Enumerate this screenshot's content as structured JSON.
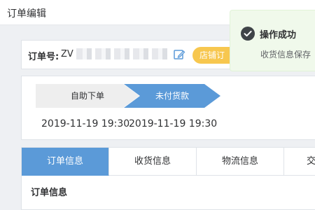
{
  "header": {
    "title": "订单编辑"
  },
  "order": {
    "label": "订单号:",
    "value_visible": "ZV",
    "tag": "店铺订"
  },
  "progress": {
    "steps": [
      {
        "label": "自助下单",
        "time": "2019-11-19 19:30"
      },
      {
        "label": "未付货款",
        "time": "2019-11-19 19:30"
      }
    ]
  },
  "tabs": [
    {
      "label": "订单信息",
      "active": true
    },
    {
      "label": "收货信息",
      "active": false
    },
    {
      "label": "物流信息",
      "active": false
    },
    {
      "label": "交",
      "active": false
    }
  ],
  "section": {
    "title": "订单信息"
  },
  "toast": {
    "title": "操作成功",
    "message": "收货信息保存",
    "icon": "check-circle-icon"
  },
  "colors": {
    "primary": "#5b9ad8",
    "tag": "#f7c74f",
    "success": "#3f4448"
  },
  "icons": {
    "edit": "edit-icon"
  }
}
